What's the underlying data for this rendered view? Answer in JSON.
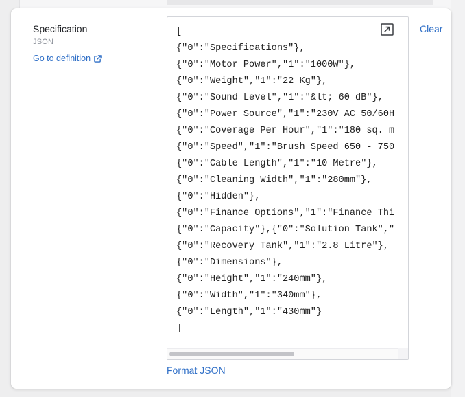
{
  "field": {
    "label": "Specification",
    "type": "JSON",
    "definition_link": "Go to definition"
  },
  "editor": {
    "lines": [
      "[",
      "{\"0\":\"Specifications\"},",
      "{\"0\":\"Motor Power\",\"1\":\"1000W\"},",
      "{\"0\":\"Weight\",\"1\":\"22 Kg\"},",
      "{\"0\":\"Sound Level\",\"1\":\"&lt; 60 dB\"},",
      "{\"0\":\"Power Source\",\"1\":\"230V AC 50/60H",
      "{\"0\":\"Coverage Per Hour\",\"1\":\"180 sq. m",
      "{\"0\":\"Speed\",\"1\":\"Brush Speed 650 - 750",
      "{\"0\":\"Cable Length\",\"1\":\"10 Metre\"},",
      "{\"0\":\"Cleaning Width\",\"1\":\"280mm\"},",
      "{\"0\":\"Hidden\"},",
      "{\"0\":\"Finance Options\",\"1\":\"Finance Thi",
      "{\"0\":\"Capacity\"},{\"0\":\"Solution Tank\",\"",
      "{\"0\":\"Recovery Tank\",\"1\":\"2.8 Litre\"},",
      "{\"0\":\"Dimensions\"},",
      "{\"0\":\"Height\",\"1\":\"240mm\"},",
      "{\"0\":\"Width\",\"1\":\"340mm\"},",
      "{\"0\":\"Length\",\"1\":\"430mm\"}",
      "]"
    ]
  },
  "actions": {
    "clear": "Clear",
    "format_json": "Format JSON"
  },
  "icons": {
    "external_link": "external-link-icon",
    "expand": "expand-icon"
  },
  "colors": {
    "link": "#2f6fc7",
    "label": "#1d1f23",
    "muted": "#8a8f98",
    "border": "#d3d5da"
  }
}
